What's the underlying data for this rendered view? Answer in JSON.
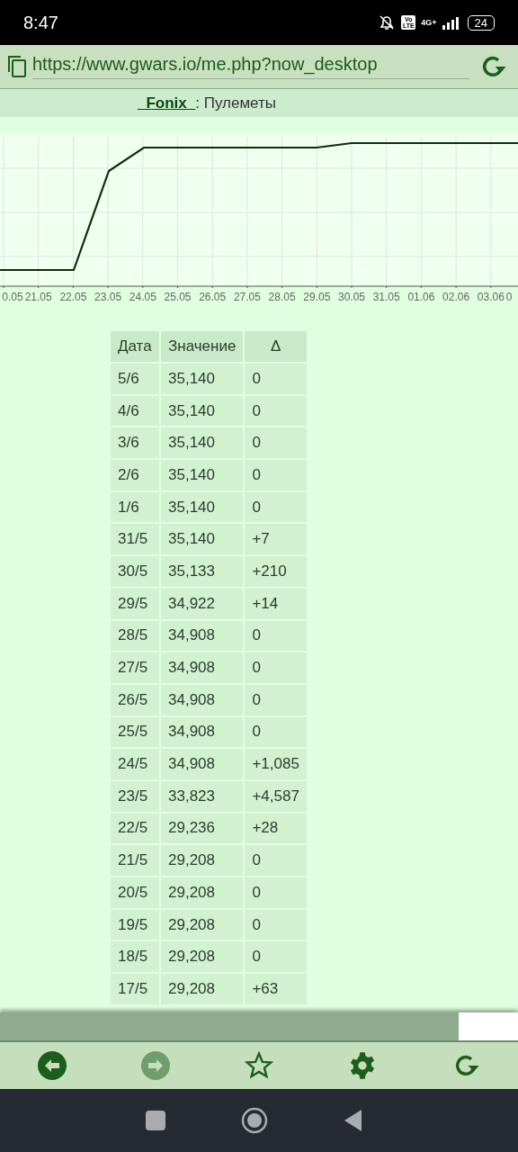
{
  "status_bar": {
    "time": "8:47",
    "network": "4G+",
    "volte": "Vo LTE",
    "battery": "24"
  },
  "address_bar": {
    "url": "https://www.gwars.io/me.php?now_desktop"
  },
  "header": {
    "player": "_Fonix_",
    "title": ": Пулеметы"
  },
  "chart": {
    "x_labels": [
      "0.05",
      "21.05",
      "22.05",
      "23.05",
      "24.05",
      "25.05",
      "26.05",
      "27.05",
      "28.05",
      "29.05",
      "30.05",
      "31.05",
      "01.06",
      "02.06",
      "03.06",
      "0"
    ]
  },
  "table": {
    "columns": [
      "Дата",
      "Значение",
      "Δ"
    ],
    "rows": [
      [
        "5/6",
        "35,140",
        "0"
      ],
      [
        "4/6",
        "35,140",
        "0"
      ],
      [
        "3/6",
        "35,140",
        "0"
      ],
      [
        "2/6",
        "35,140",
        "0"
      ],
      [
        "1/6",
        "35,140",
        "0"
      ],
      [
        "31/5",
        "35,140",
        "+7"
      ],
      [
        "30/5",
        "35,133",
        "+210"
      ],
      [
        "29/5",
        "34,922",
        "+14"
      ],
      [
        "28/5",
        "34,908",
        "0"
      ],
      [
        "27/5",
        "34,908",
        "0"
      ],
      [
        "26/5",
        "34,908",
        "0"
      ],
      [
        "25/5",
        "34,908",
        "0"
      ],
      [
        "24/5",
        "34,908",
        "+1,085"
      ],
      [
        "23/5",
        "33,823",
        "+4,587"
      ],
      [
        "22/5",
        "29,236",
        "+28"
      ],
      [
        "21/5",
        "29,208",
        "0"
      ],
      [
        "20/5",
        "29,208",
        "0"
      ],
      [
        "19/5",
        "29,208",
        "0"
      ],
      [
        "18/5",
        "29,208",
        "0"
      ],
      [
        "17/5",
        "29,208",
        "+63"
      ]
    ]
  },
  "progress": {
    "level": 0.885
  },
  "toolbar": [
    {
      "kind": "back",
      "disabled": false
    },
    {
      "kind": "forward",
      "disabled": true
    },
    {
      "kind": "bookmark",
      "disabled": false
    },
    {
      "kind": "settings",
      "disabled": false
    },
    {
      "kind": "reload",
      "disabled": false
    }
  ]
}
